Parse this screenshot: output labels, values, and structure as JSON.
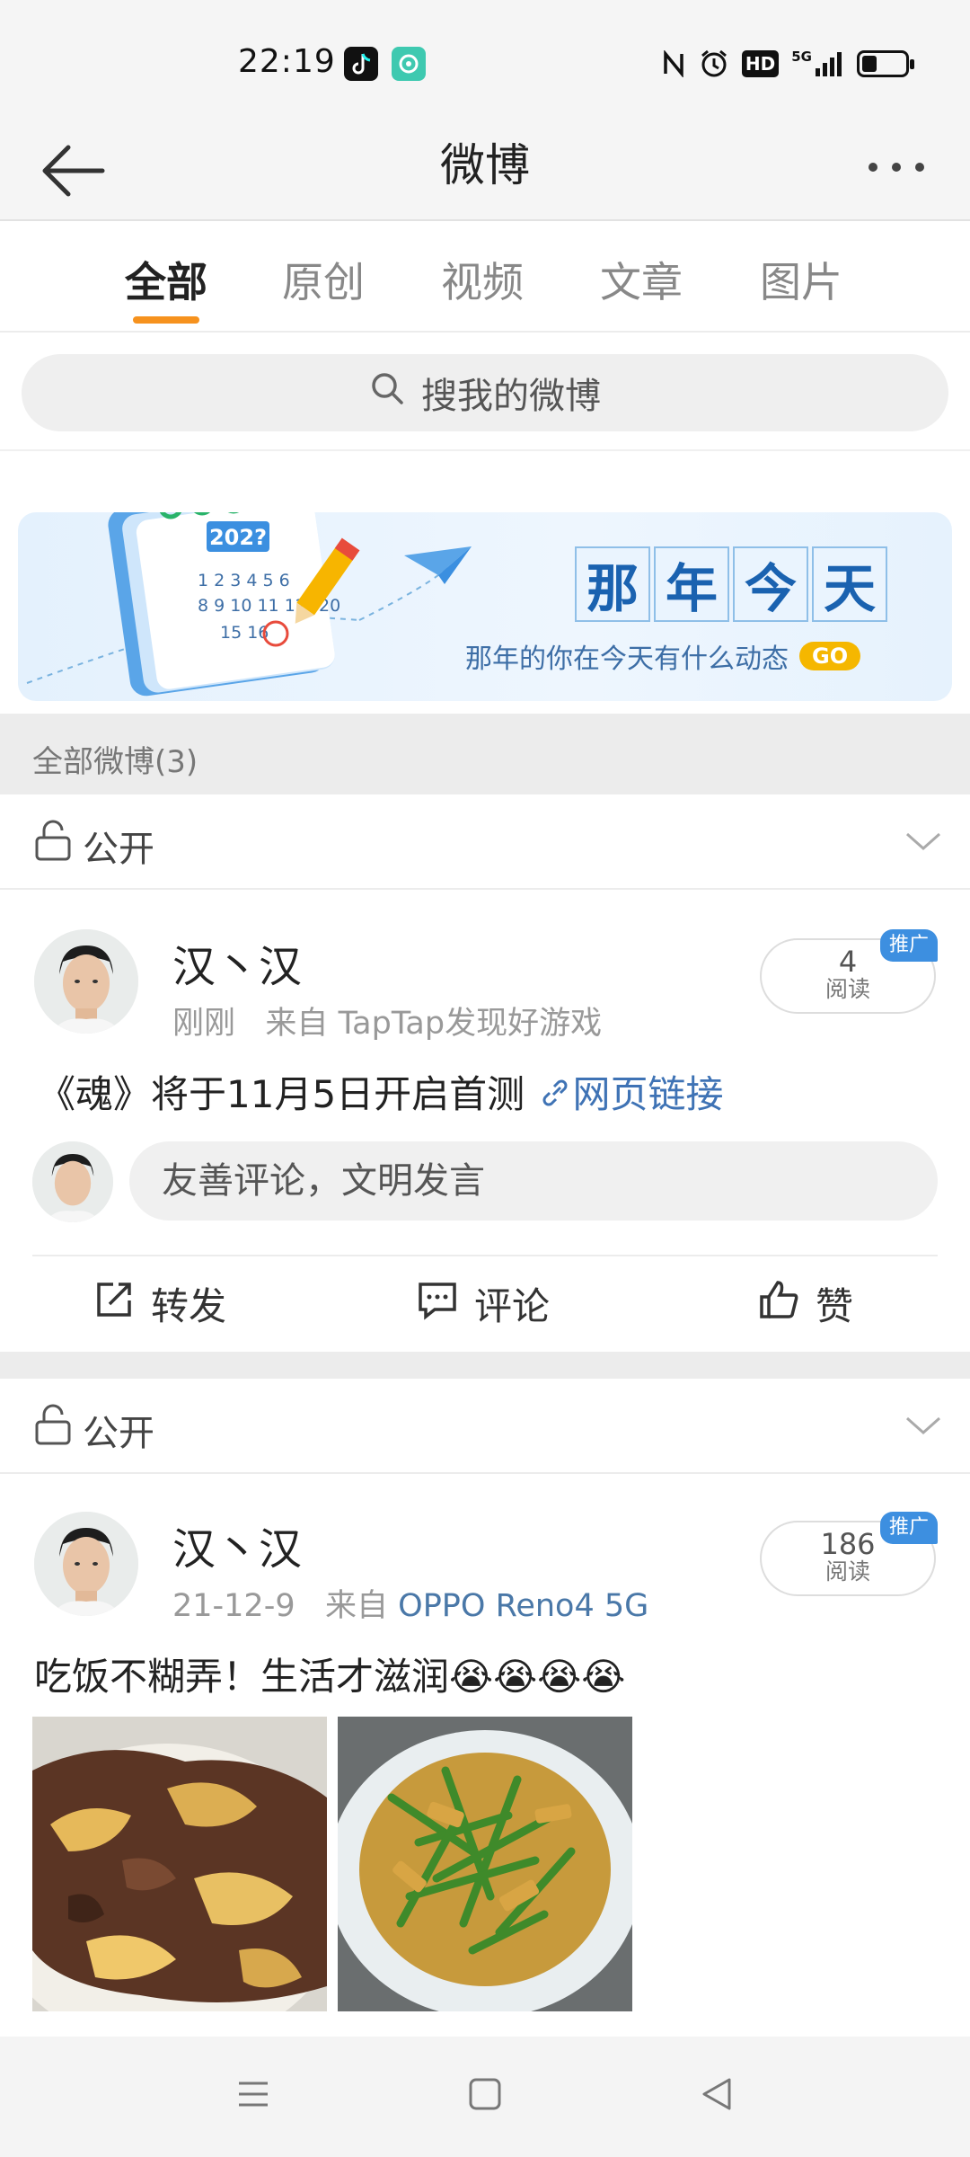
{
  "status_bar": {
    "time": "22:19",
    "network": "5G",
    "hd_label": "HD",
    "battery_level": 0.35,
    "icons": [
      "tiktok-icon",
      "chat-app-icon",
      "nfc-icon",
      "alarm-icon",
      "hd-icon",
      "signal-icon",
      "battery-icon"
    ]
  },
  "header": {
    "title": "微博",
    "back_icon": "back-arrow-icon",
    "more_icon": "more-dots-icon"
  },
  "tabs": [
    {
      "label": "全部",
      "active": true
    },
    {
      "label": "原创",
      "active": false
    },
    {
      "label": "视频",
      "active": false
    },
    {
      "label": "文章",
      "active": false
    },
    {
      "label": "图片",
      "active": false
    }
  ],
  "search": {
    "placeholder": "搜我的微博"
  },
  "banner": {
    "year_tag": "202?",
    "calendar_numbers": "1 2 3 4 5 6",
    "title_chars": [
      "那",
      "年",
      "今",
      "天"
    ],
    "subtitle": "那年的你在今天有什么动态",
    "go_label": "GO"
  },
  "section": {
    "header": "全部微博(3)"
  },
  "posts": [
    {
      "privacy": "公开",
      "author": "汉丶汉",
      "time": "刚刚",
      "source_prefix": "来自",
      "source": "TapTap发现好游戏",
      "read_count": "4",
      "read_label": "阅读",
      "promo_label": "推广",
      "text": "《魂》将于11月5日开启首测",
      "link_text": "网页链接",
      "comment_placeholder": "友善评论，文明发言",
      "actions": {
        "repost": "转发",
        "comment": "评论",
        "like": "赞"
      }
    },
    {
      "privacy": "公开",
      "author": "汉丶汉",
      "time": "21-12-9",
      "source_prefix": "来自",
      "source": "OPPO Reno4 5G",
      "read_count": "186",
      "read_label": "阅读",
      "promo_label": "推广",
      "text": "吃饭不糊弄！生活才滋润😭😭😭😭",
      "photos": [
        "fried-potato-beef-photo",
        "garlic-sprout-stirfry-photo"
      ]
    }
  ],
  "system_nav": {
    "icons": [
      "menu-icon",
      "home-square-icon",
      "back-triangle-icon"
    ]
  }
}
